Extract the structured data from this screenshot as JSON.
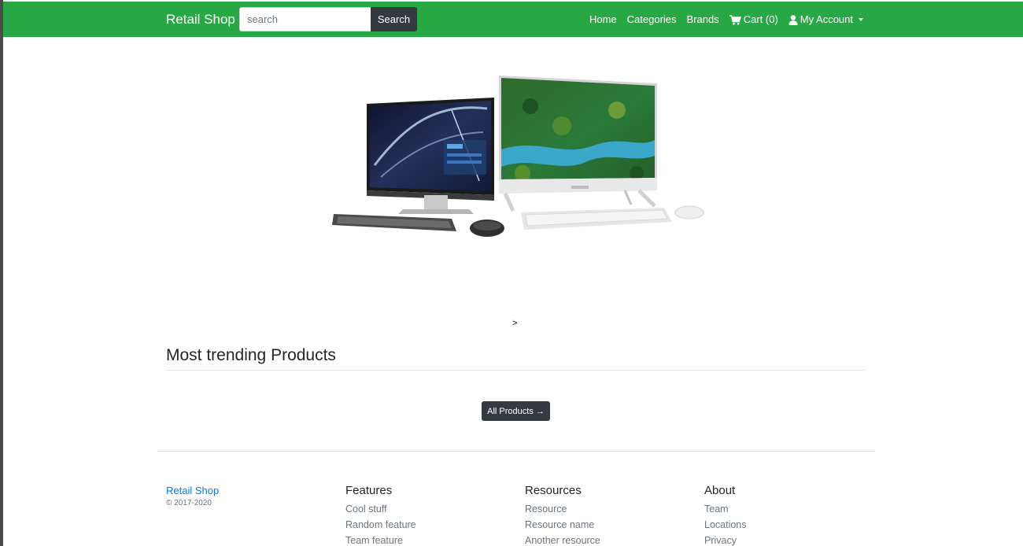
{
  "navbar": {
    "brand": "Retail Shop",
    "search_placeholder": "search",
    "search_button": "Search",
    "links": {
      "home": "Home",
      "categories": "Categories",
      "brands": "Brands",
      "cart": "Cart (0)",
      "account": "My Account"
    },
    "colors": {
      "bar": "#28a745",
      "dark": "#343a40"
    }
  },
  "hero": {
    "carousel_next": ">"
  },
  "trending": {
    "title": "Most trending Products",
    "all_products_label": "All Products →"
  },
  "footer": {
    "brand": "Retail Shop",
    "copyright": "© 2017-2020",
    "columns": [
      {
        "heading": "Features",
        "items": [
          "Cool stuff",
          "Random feature",
          "Team feature"
        ]
      },
      {
        "heading": "Resources",
        "items": [
          "Resource",
          "Resource name",
          "Another resource"
        ]
      },
      {
        "heading": "About",
        "items": [
          "Team",
          "Locations",
          "Privacy"
        ]
      }
    ]
  }
}
